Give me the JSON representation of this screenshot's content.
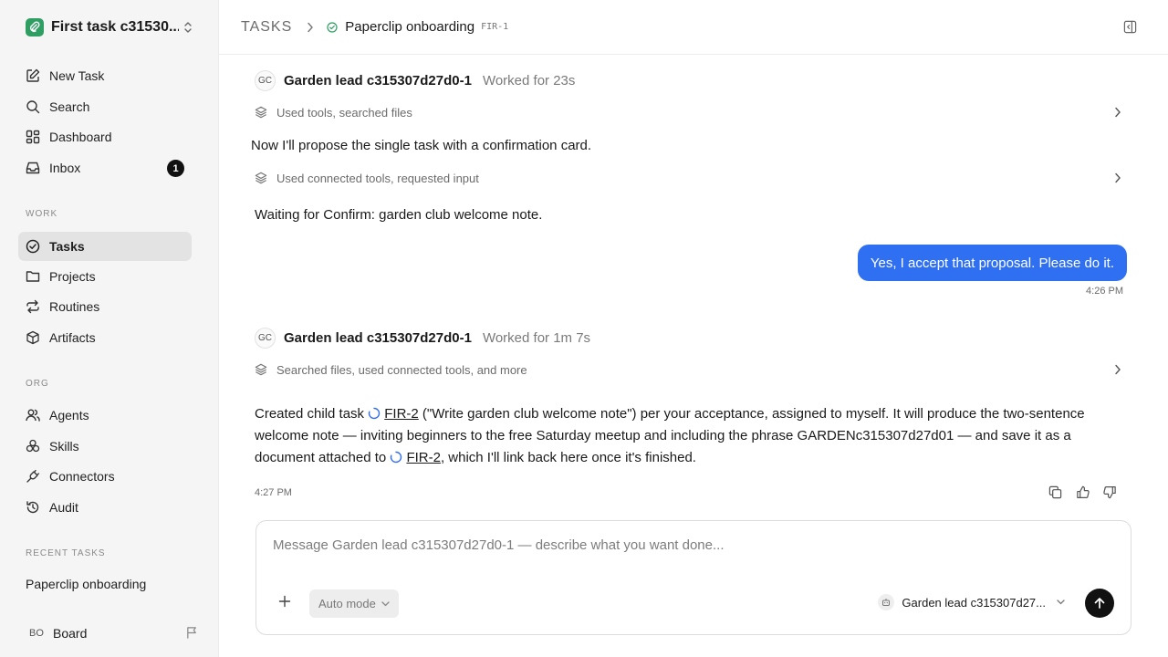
{
  "workspace": {
    "name": "First task c31530...",
    "logo_icon": "paperclip-logo-icon",
    "accent": "#2f9e63"
  },
  "nav": [
    {
      "label": "New Task",
      "icon": "edit-icon"
    },
    {
      "label": "Search",
      "icon": "search-icon"
    },
    {
      "label": "Dashboard",
      "icon": "dashboard-icon"
    },
    {
      "label": "Inbox",
      "icon": "inbox-icon",
      "badge": "1"
    }
  ],
  "sections": {
    "work": "WORK",
    "org": "ORG",
    "recent": "RECENT TASKS"
  },
  "work_items": [
    {
      "label": "Tasks",
      "icon": "check-circle-icon",
      "active": true
    },
    {
      "label": "Projects",
      "icon": "folder-icon"
    },
    {
      "label": "Routines",
      "icon": "repeat-icon"
    },
    {
      "label": "Artifacts",
      "icon": "box-icon"
    }
  ],
  "org_items": [
    {
      "label": "Agents",
      "icon": "users-icon"
    },
    {
      "label": "Skills",
      "icon": "skills-icon"
    },
    {
      "label": "Connectors",
      "icon": "plug-icon"
    },
    {
      "label": "Audit",
      "icon": "history-icon"
    }
  ],
  "recent_tasks": [
    "Paperclip onboarding"
  ],
  "board": {
    "initials": "BO",
    "label": "Board"
  },
  "breadcrumb": {
    "root": "TASKS",
    "title": "Paperclip onboarding",
    "id": "FIR-1"
  },
  "conversation": {
    "turn1": {
      "initials": "GC",
      "agent": "Garden lead c315307d27d0-1",
      "meta": "Worked for 23s",
      "tool1": "Used tools, searched files",
      "text1": "Now I'll propose the single task with a confirmation card.",
      "tool2": "Used connected tools, requested input",
      "waiting": "Waiting for Confirm: garden club welcome note."
    },
    "user": {
      "text": "Yes, I accept that proposal. Please do it.",
      "time": "4:26 PM"
    },
    "turn2": {
      "initials": "GC",
      "agent": "Garden lead c315307d27d0-1",
      "meta": "Worked for 1m 7s",
      "tool": "Searched files, used connected tools, and more",
      "p1": "Created child task ",
      "link": "FIR-2",
      "p2": " (\"Write garden club welcome note\") per your acceptance, assigned to myself. It will produce the two-sentence welcome note — inviting beginners to the free Saturday meetup and including the phrase GARDENc315307d27d01 — and save it as a document attached to ",
      "p3": ", which I'll link back here once it's finished.",
      "time": "4:27 PM"
    }
  },
  "composer": {
    "placeholder": "Message Garden lead c315307d27d0-1 — describe what you want done...",
    "mode": "Auto mode",
    "agent": "Garden lead c315307d27..."
  },
  "colors": {
    "user_bubble": "#2f6ff2",
    "status_ring": "#2f6ff2",
    "done_green": "#2f9e63"
  }
}
